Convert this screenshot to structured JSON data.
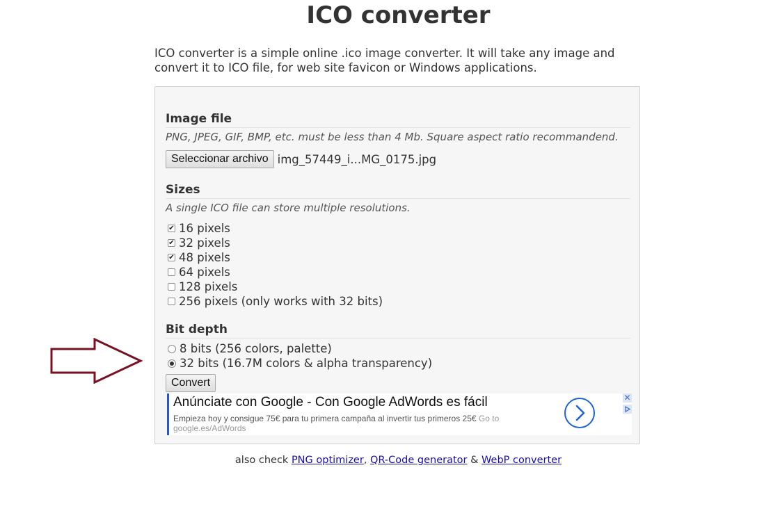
{
  "title": "ICO converter",
  "intro": "ICO converter is a simple online .ico image converter. It will take any image and convert it to ICO file, for web site favicon or Windows applications.",
  "image_file": {
    "heading": "Image file",
    "hint": "PNG, JPEG, GIF, BMP, etc. must be less than 4 Mb. Square aspect ratio recommandend.",
    "button_label": "Seleccionar archivo",
    "filename": "img_57449_i...MG_0175.jpg"
  },
  "sizes": {
    "heading": "Sizes",
    "hint": "A single ICO file can store multiple resolutions.",
    "options": [
      {
        "label": "16 pixels",
        "checked": true
      },
      {
        "label": "32 pixels",
        "checked": true
      },
      {
        "label": "48 pixels",
        "checked": true
      },
      {
        "label": "64 pixels",
        "checked": false
      },
      {
        "label": "128 pixels",
        "checked": false
      },
      {
        "label": "256 pixels (only works with 32 bits)",
        "checked": false
      }
    ]
  },
  "bit_depth": {
    "heading": "Bit depth",
    "options": [
      {
        "label": "8 bits (256 colors, palette)",
        "selected": false
      },
      {
        "label": "32 bits (16.7M colors & alpha transparency)",
        "selected": true
      }
    ]
  },
  "convert_label": "Convert",
  "ad": {
    "headline": "Anúnciate con Google - Con Google AdWords es fácil",
    "body": "Empieza hoy y consigue 75€ para tu primera campaña al invertir tus primeros 25€",
    "url": "Go to google.es/AdWords",
    "accent": "#1a64d6"
  },
  "footer": {
    "prefix": "also check",
    "link1": "PNG optimizer",
    "sep1": ",",
    "link2": "QR-Code generator",
    "sep2": "&",
    "link3": "WebP converter"
  },
  "colors": {
    "arrow": "#7a1023",
    "link": "#1a0dab",
    "panel_bg": "#f6f6f6"
  }
}
